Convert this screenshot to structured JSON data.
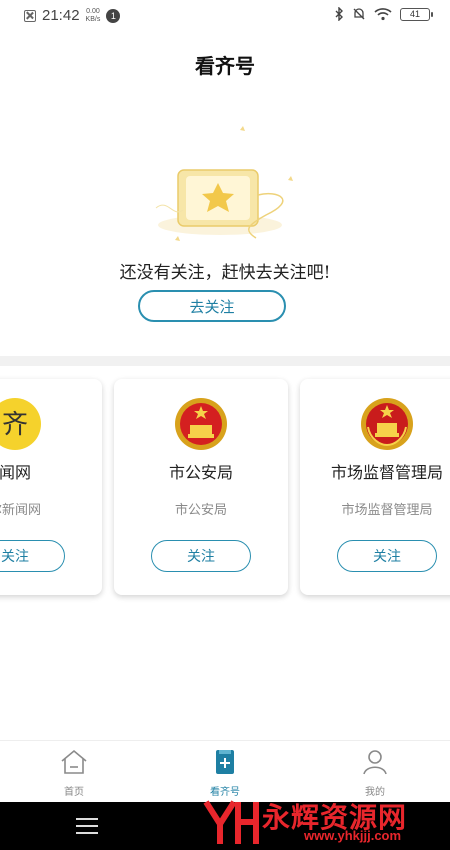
{
  "status_bar": {
    "time": "21:42",
    "speed_value": "0.00",
    "speed_unit": "KB/s",
    "notification_count": "1",
    "battery": "41"
  },
  "header": {
    "title": "看齐号"
  },
  "empty_state": {
    "message": "还没有关注，赶快去关注吧!",
    "cta_label": "去关注"
  },
  "recommended": [
    {
      "name": "闻网",
      "desc": "尔新闻网",
      "button": "关注",
      "logo": "qi-news-logo"
    },
    {
      "name": "市公安局",
      "desc": "市公安局",
      "button": "关注",
      "logo": "police-emblem"
    },
    {
      "name": "市场监督管理局",
      "desc": "市场监督管理局",
      "button": "关注",
      "logo": "national-emblem"
    }
  ],
  "tabs": [
    {
      "label": "首页",
      "icon": "home-icon",
      "active": false
    },
    {
      "label": "看齐号",
      "icon": "bookmark-plus-icon",
      "active": true
    },
    {
      "label": "我的",
      "icon": "user-icon",
      "active": false
    }
  ],
  "colors": {
    "accent": "#1e7fa3",
    "watermark": "#e8262c"
  },
  "watermark": {
    "text": "永辉资源网",
    "url": "www.yhkjjj.com"
  }
}
